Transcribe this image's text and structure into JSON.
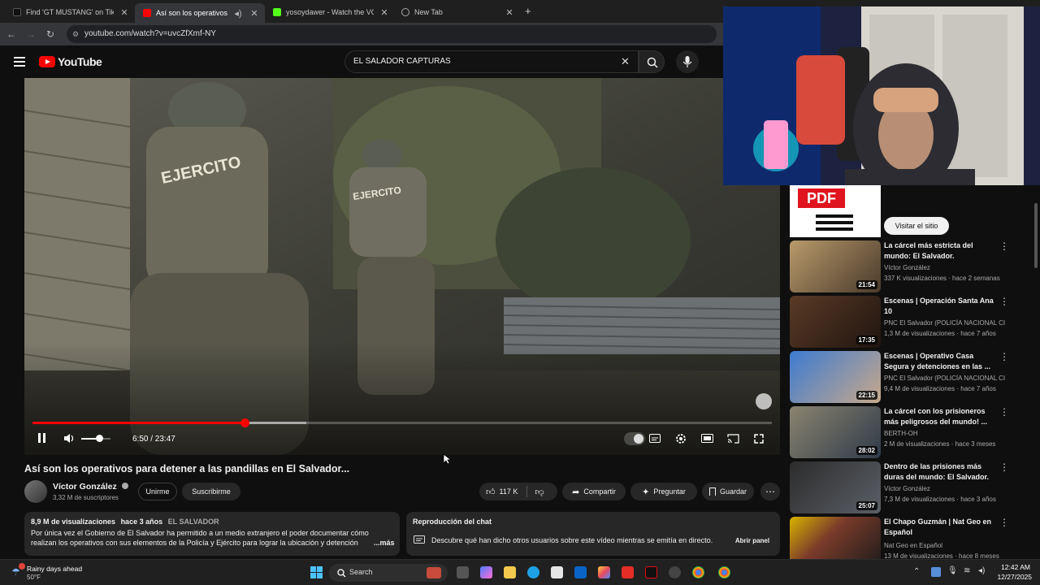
{
  "browser": {
    "tabs": [
      {
        "title": "Find 'GT MUSTANG' on TikTok |",
        "active": false
      },
      {
        "title": "Así son los operativos para",
        "active": true
      },
      {
        "title": "yosoydawer - Watch the VOD c",
        "active": false
      },
      {
        "title": "New Tab",
        "active": false
      }
    ],
    "url": "youtube.com/watch?v=uvcZfXmf-NY"
  },
  "youtube": {
    "logo": "YouTube",
    "search_value": "EL SALADOR CAPTURAS"
  },
  "player": {
    "time": "6:50 / 23:47",
    "progress": 0.287,
    "volume": 0.6
  },
  "video": {
    "title": "Así son los operativos para detener a las pandillas en El Salvador...",
    "channel": "Víctor González",
    "subscribers": "3,32 M de suscriptores",
    "join_label": "Unirme",
    "subscribe_label": "Suscribirme",
    "likes": "117 K",
    "share_label": "Compartir",
    "ask_label": "Preguntar",
    "save_label": "Guardar",
    "views": "8,9 M de visualizaciones",
    "age": "hace 3 años",
    "tag": "EL SALVADOR",
    "description": "Por única vez el Gobierno de El Salvador ha permitido a un medio extranjero el poder documentar cómo realizan los operativos con sus elementos de la Policía y Ejército para lograr la ubicación y detención",
    "more": "...más"
  },
  "chat": {
    "title": "Reproducción del chat",
    "text": "Descubre qué han dicho otros usuarios sobre este vídeo mientras se emitía en directo.",
    "open_label": "Abrir panel"
  },
  "ad": {
    "badge": "PDF",
    "button": "Visitar el sitio"
  },
  "recommendations": [
    {
      "title": "La cárcel más estricta del mundo: El Salvador.",
      "channel": "Víctor González",
      "meta": "337 K visualizaciones · hace 2 semanas",
      "duration": "21:54"
    },
    {
      "title": "Escenas | Operación Santa Ana 10",
      "channel": "PNC El Salvador (POLICÍA NACIONAL CI...",
      "meta": "1,3 M de visualizaciones · hace 7 años",
      "duration": "17:35"
    },
    {
      "title": "Escenas | Operativo Casa Segura  y detenciones en las ...",
      "channel": "PNC El Salvador (POLICÍA NACIONAL CI...",
      "meta": "9,4 M de visualizaciones · hace 7 años",
      "duration": "22:15"
    },
    {
      "title": "La cárcel con los prisioneros más peligrosos del mundo! ...",
      "channel": "BERTH-OH",
      "meta": "2 M de visualizaciones · hace 3 meses",
      "duration": "28:02"
    },
    {
      "title": "Dentro de las prisiones más duras del mundo: El Salvador.",
      "channel": "Víctor González",
      "meta": "7,3 M de visualizaciones · hace 3 años",
      "duration": "25:07"
    },
    {
      "title": "El Chapo Guzmán | Nat Geo en Español",
      "channel": "Nat Geo en Español",
      "meta": "13 M de visualizaciones · hace 8 meses",
      "duration": ""
    }
  ],
  "taskbar": {
    "weather_title": "Rainy days ahead",
    "weather_temp": "50°F",
    "search_label": "Search",
    "time": "12:42 AM",
    "date": "12/27/2025"
  },
  "colors": {
    "yt_red": "#ff0000",
    "background": "#0f0f0f",
    "pill": "#272727"
  }
}
